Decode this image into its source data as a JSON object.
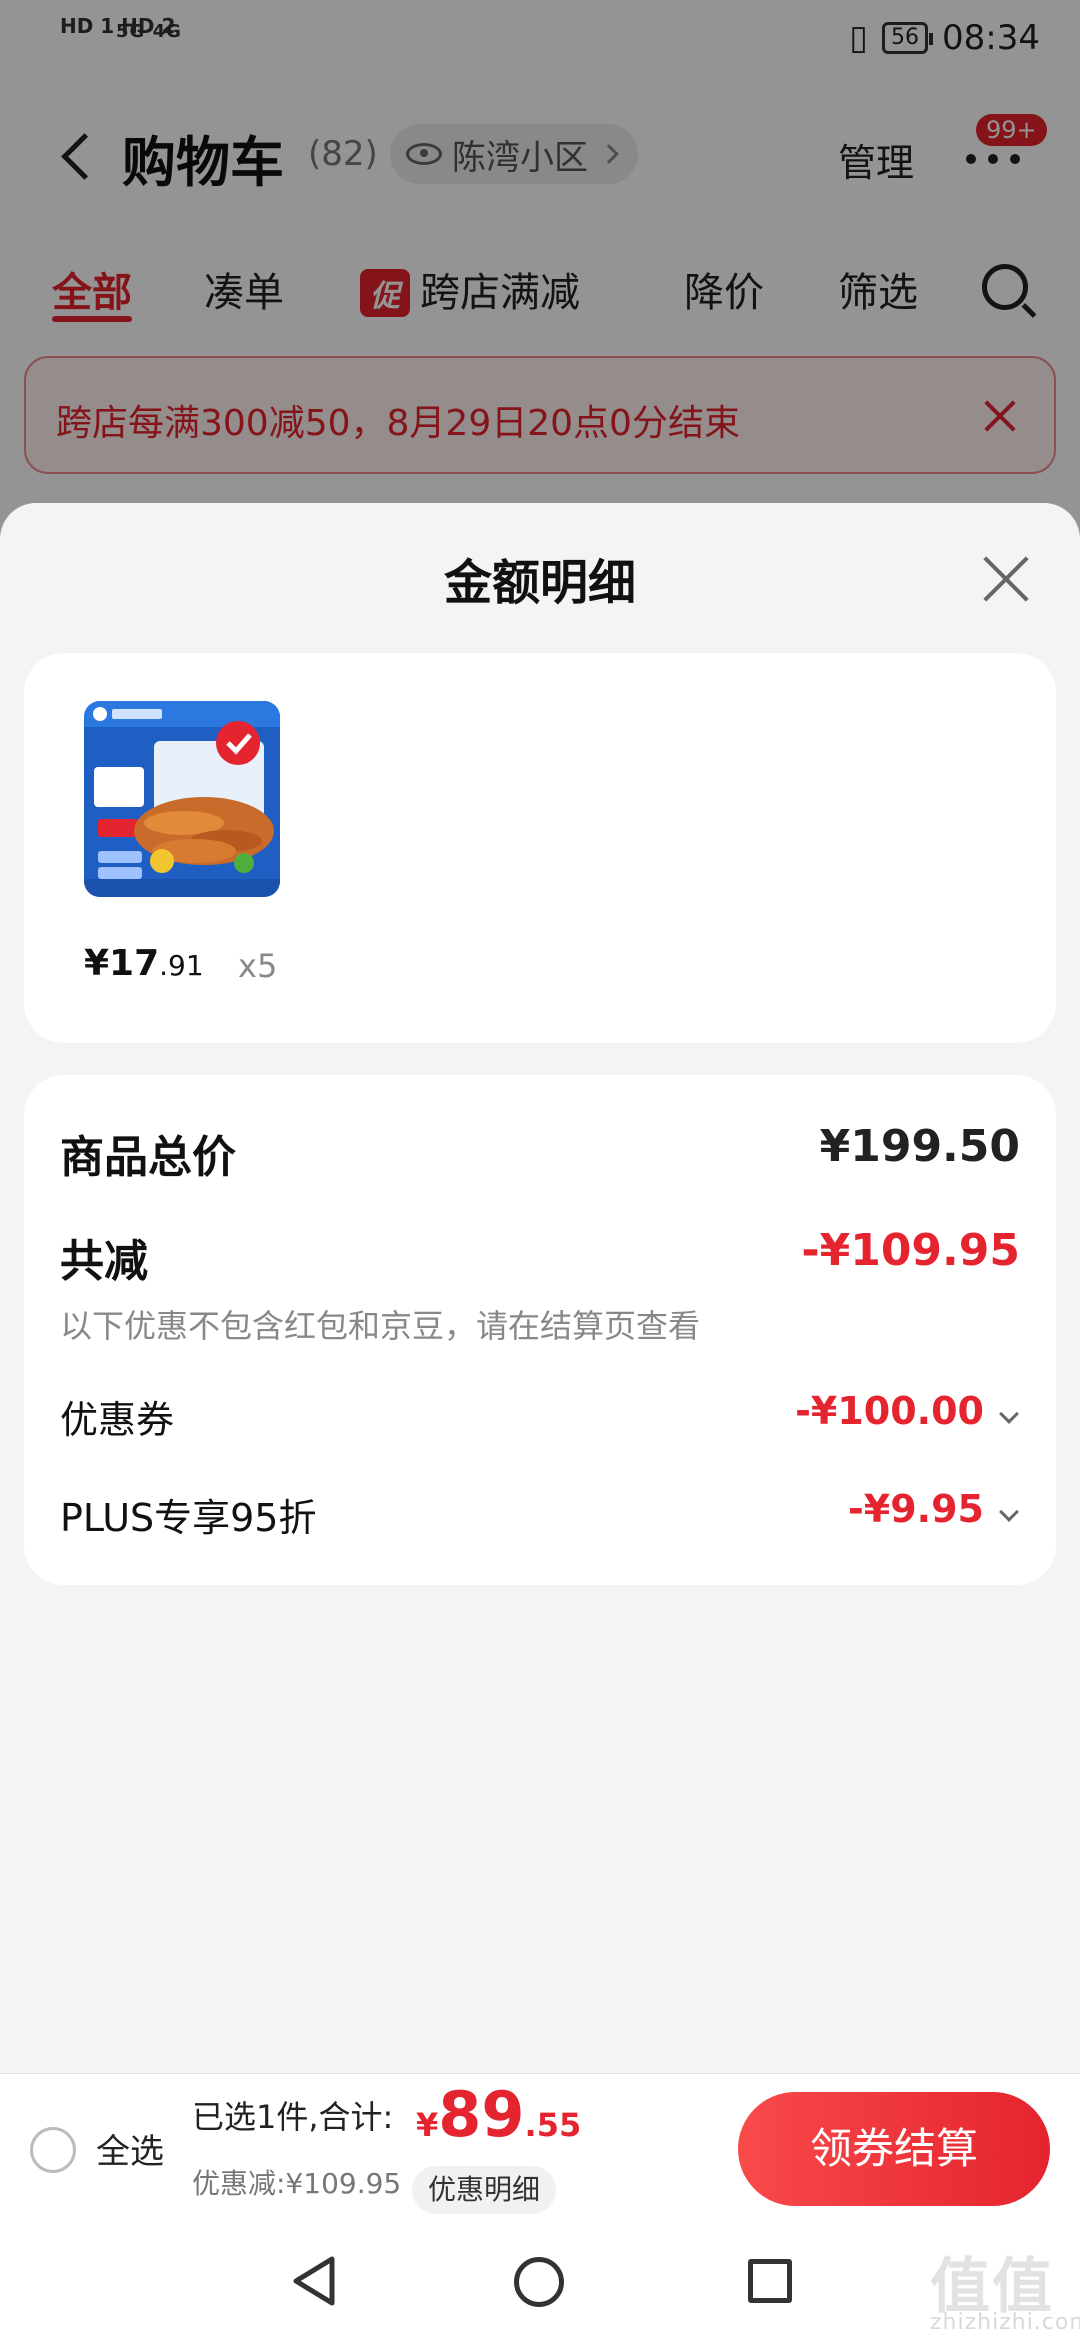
{
  "status_bar": {
    "left": "HD 1 HD 2",
    "network": "5G 4G",
    "battery": "56",
    "time": "08:34"
  },
  "cart_header": {
    "title": "购物车",
    "count": "(82)",
    "location": "陈湾小区",
    "manage": "管理",
    "badge": "99+"
  },
  "tabs": [
    {
      "label": "全部",
      "active": true
    },
    {
      "label": "凑单"
    },
    {
      "label": "跨店满减",
      "badge": "促"
    },
    {
      "label": "降价"
    },
    {
      "label": "筛选"
    }
  ],
  "promo_banner": {
    "text": "跨店每满300减50，8月29日20点0分结束"
  },
  "sheet": {
    "title": "金额明细",
    "product": {
      "price_int": "¥17",
      "price_dec": ".91",
      "qty": "x5"
    },
    "summary": {
      "total_label": "商品总价",
      "total_value": "¥199.50",
      "reduce_label": "共减",
      "reduce_value": "-¥109.95",
      "reduce_note": "以下优惠不包含红包和京豆，请在结算页查看",
      "coupon_label": "优惠券",
      "coupon_value": "-¥100.00",
      "plus_label": "PLUS专享95折",
      "plus_value": "-¥9.95"
    }
  },
  "bottom_bar": {
    "select_all": "全选",
    "selected_text": "已选1件,合计:",
    "total_sym": "¥",
    "total_int": "89",
    "total_dec": ".55",
    "discount_text": "优惠减:¥109.95",
    "detail_btn": "优惠明细",
    "checkout": "领券结算"
  },
  "watermark": {
    "main": "值值值",
    "domain": "zhizhizhi.com"
  },
  "colors": {
    "accent": "#e4242e",
    "sheet_bg": "#f4f4f4"
  }
}
